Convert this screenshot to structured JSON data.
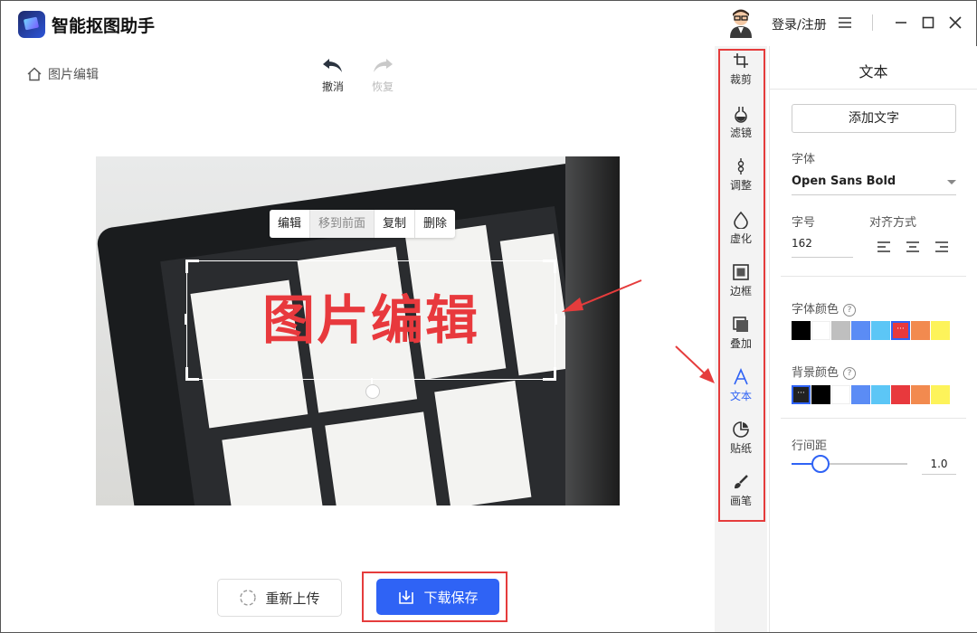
{
  "app": {
    "title": "智能抠图助手",
    "login_label": "登录/注册"
  },
  "breadcrumb": {
    "label": "图片编辑"
  },
  "history": {
    "undo_label": "撤消",
    "redo_label": "恢复"
  },
  "canvas": {
    "overlay_text": "图片编辑",
    "overlay_color": "#e8393d",
    "context_menu": [
      "编辑",
      "移到前面",
      "复制",
      "删除"
    ]
  },
  "actions": {
    "reupload_label": "重新上传",
    "download_label": "下载保存",
    "primary_color": "#2f63f5"
  },
  "tools": [
    {
      "label": "裁剪",
      "icon": "crop-icon"
    },
    {
      "label": "滤镜",
      "icon": "filter-icon"
    },
    {
      "label": "调整",
      "icon": "adjust-icon"
    },
    {
      "label": "虚化",
      "icon": "blur-icon"
    },
    {
      "label": "边框",
      "icon": "border-icon"
    },
    {
      "label": "叠加",
      "icon": "overlay-icon"
    },
    {
      "label": "文本",
      "icon": "text-icon",
      "active": true
    },
    {
      "label": "贴纸",
      "icon": "sticker-icon"
    },
    {
      "label": "画笔",
      "icon": "brush-icon"
    }
  ],
  "panel": {
    "title": "文本",
    "add_text_label": "添加文字",
    "font_label": "字体",
    "font_value": "Open Sans Bold",
    "size_label": "字号",
    "size_value": "162",
    "align_label": "对齐方式",
    "font_color_label": "字体颜色",
    "font_colors": [
      "#000000",
      "#ffffff",
      "#bfbfbf",
      "#5b8cf5",
      "#5cc6f6",
      "#e8393d",
      "#f28a4f",
      "#fdf35a"
    ],
    "font_color_selected": 5,
    "bg_color_label": "背景颜色",
    "bg_colors": [
      "#222222",
      "#000000",
      "#ffffff",
      "#5b8cf5",
      "#5cc6f6",
      "#e8393d",
      "#f28a4f",
      "#fdf35a"
    ],
    "bg_color_selected": 0,
    "line_spacing_label": "行间距",
    "line_spacing_value": "1.0",
    "line_spacing_fraction": 0.25
  }
}
